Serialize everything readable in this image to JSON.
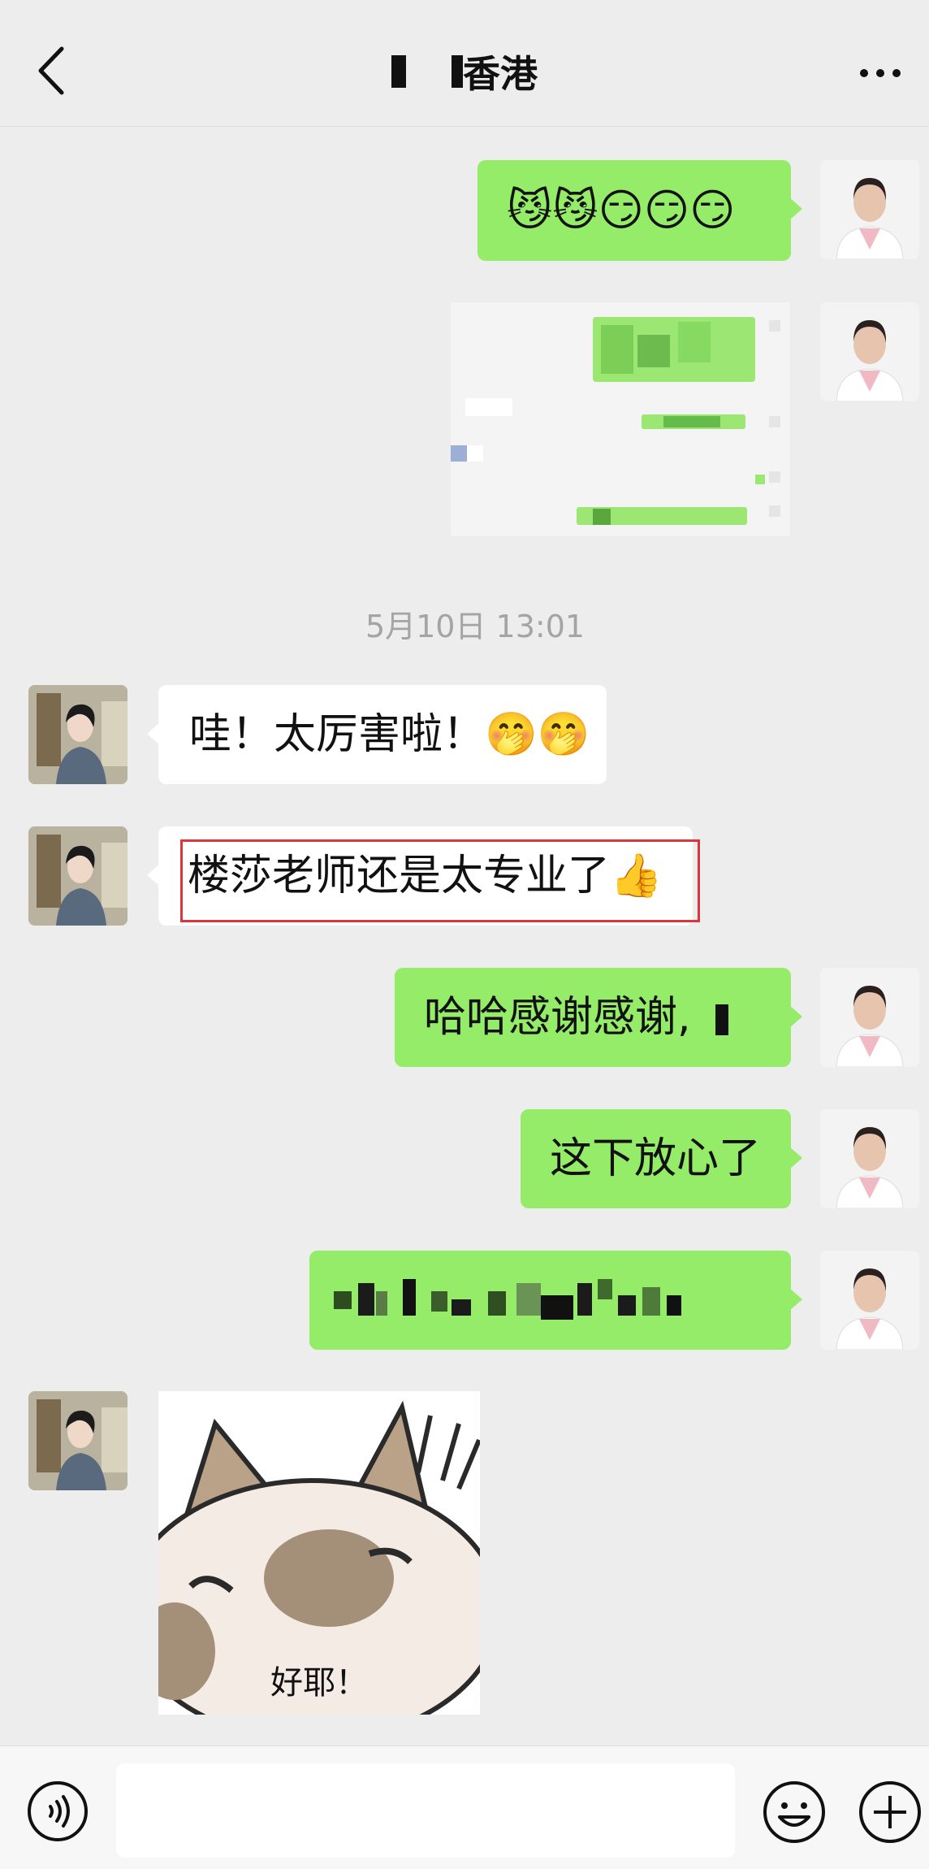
{
  "header": {
    "title": "香港",
    "back_label": "返回",
    "more_label": "更多"
  },
  "timestamp": "5月10日 13:01",
  "messages": [
    {
      "side": "right",
      "type": "emoji",
      "content": "😼😼😏😏😏"
    },
    {
      "side": "right",
      "type": "image",
      "content": "screenshot-of-chat"
    },
    {
      "side": "left",
      "type": "text",
      "text": "哇！太厉害啦！",
      "emoji": "🤭🤭"
    },
    {
      "side": "left",
      "type": "text",
      "text": "楼莎老师还是太专业了",
      "emoji": "👍"
    },
    {
      "side": "right",
      "type": "text",
      "text": "哈哈感谢感谢,"
    },
    {
      "side": "right",
      "type": "text",
      "text": "这下放心了"
    },
    {
      "side": "right",
      "type": "text",
      "text": ""
    },
    {
      "side": "left",
      "type": "sticker",
      "caption": "好耶！"
    }
  ],
  "input": {
    "value": "",
    "placeholder": ""
  },
  "colors": {
    "background": "#ededed",
    "self_bubble": "#95ec69",
    "other_bubble": "#ffffff",
    "highlight": "#d9373c"
  },
  "icons": [
    "back-arrow-icon",
    "more-dots-icon",
    "voice-icon",
    "emoji-icon",
    "plus-icon"
  ]
}
